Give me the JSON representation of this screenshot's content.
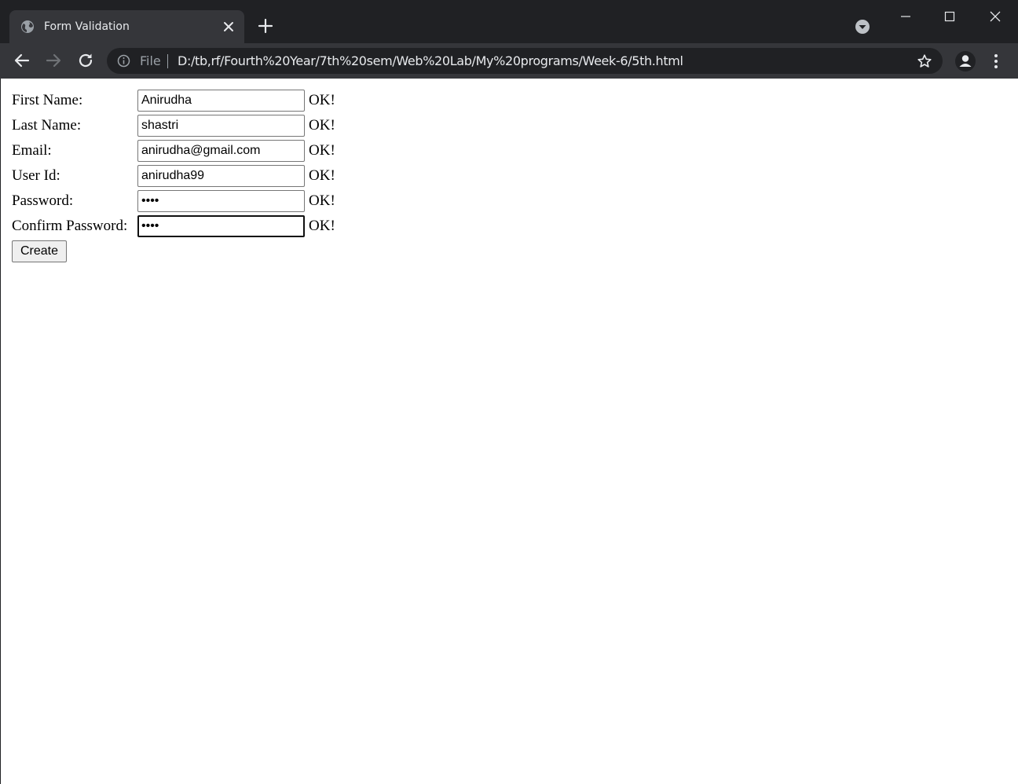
{
  "tab": {
    "title": "Form Validation",
    "favicon": "globe-icon",
    "close_icon": "close-icon"
  },
  "new_tab_icon": "plus-icon",
  "tab_search_icon": "chevron-down-icon",
  "window_controls": [
    "minimize-icon",
    "maximize-icon",
    "close-icon"
  ],
  "toolbar": {
    "back_icon": "arrow-left-icon",
    "forward_icon": "arrow-right-icon",
    "reload_icon": "reload-icon",
    "scheme_label": "File",
    "url": "D:/tb,rf/Fourth%20Year/7th%20sem/Web%20Lab/My%20programs/Week-6/5th.html",
    "bookmark_icon": "star-icon",
    "profile_icon": "person-icon",
    "menu_icon": "more-vertical-icon"
  },
  "form": {
    "rows": [
      {
        "label": "First Name:",
        "value": "Anirudha",
        "type": "text",
        "status": "OK!"
      },
      {
        "label": "Last Name:",
        "value": "shastri",
        "type": "text",
        "status": "OK!"
      },
      {
        "label": "Email:",
        "value": "anirudha@gmail.com",
        "type": "text",
        "status": "OK!"
      },
      {
        "label": "User Id:",
        "value": "anirudha99",
        "type": "text",
        "status": "OK!"
      },
      {
        "label": "Password:",
        "value": "••••",
        "type": "password",
        "status": "OK!"
      },
      {
        "label": "Confirm Password:",
        "value": "••••",
        "type": "password",
        "status": "OK!",
        "focused": true
      }
    ],
    "submit_label": "Create"
  },
  "colors": {
    "tabstrip": "#202124",
    "toolbar": "#35363a",
    "omnibox": "#202124",
    "text_light": "#e8eaed",
    "text_muted": "#9aa0a6"
  }
}
